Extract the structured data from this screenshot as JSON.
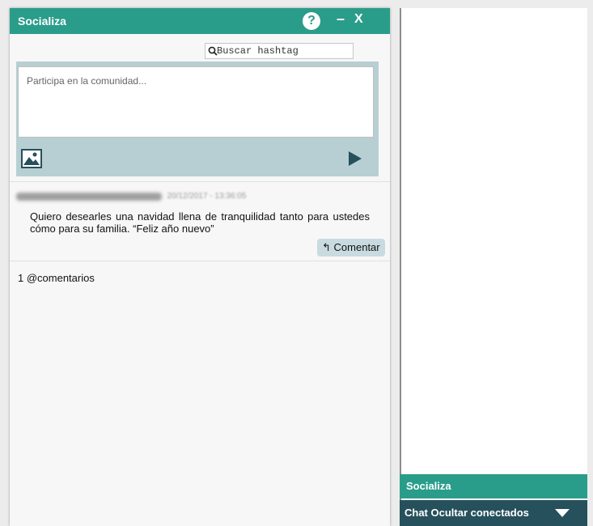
{
  "window": {
    "title": "Socializa",
    "help_label": "?",
    "minimize_label": "–",
    "close_label": "X"
  },
  "search": {
    "placeholder": "Buscar hashtag"
  },
  "composer": {
    "placeholder": "Participa en la comunidad..."
  },
  "post": {
    "timestamp": "20/12/2017 - 13:36:05",
    "body": "Quiero desearles una navidad llena de tranquilidad tanto para ustedes cómo para su familia. “Feliz año nuevo”",
    "comment_label": "Comentar"
  },
  "comments_count": "1 @comentarios",
  "sidebar": {
    "socializa_label": "Socializa",
    "chat_label": "Chat Ocultar conectados"
  },
  "colors": {
    "accent": "#2a9d8a",
    "dark": "#26505c",
    "composer_bg": "#b7cfd3"
  }
}
